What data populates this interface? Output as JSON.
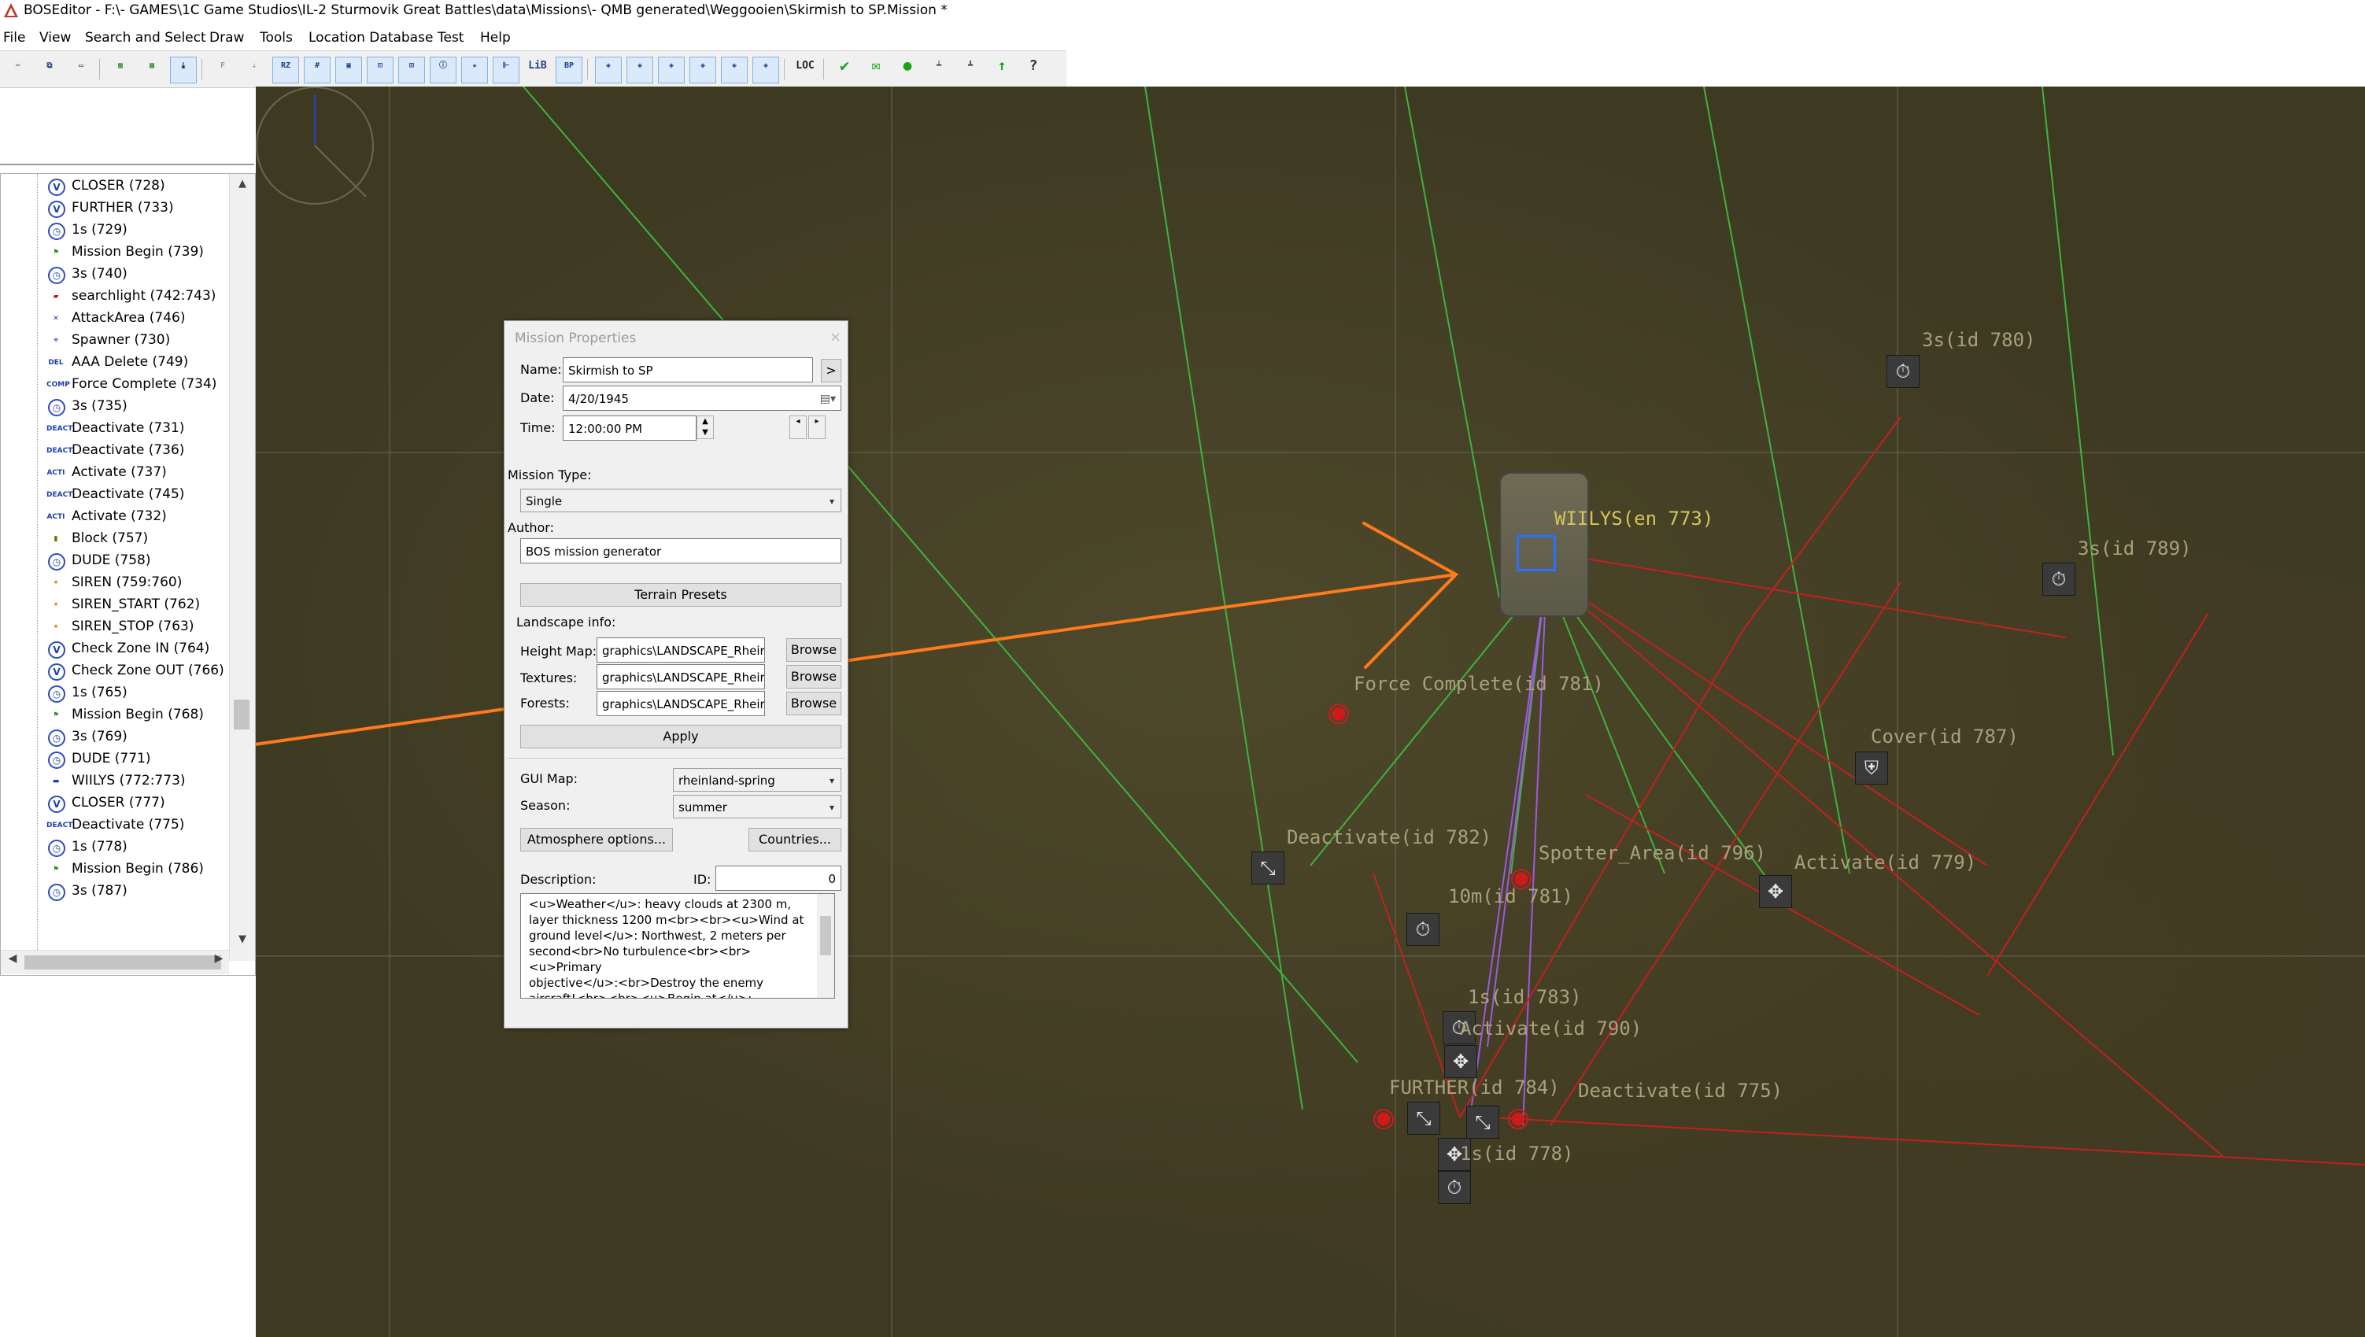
{
  "window": {
    "title": "BOSEditor - F:\\- GAMES\\1C Game Studios\\IL-2 Sturmovik Great Battles\\data\\Missions\\- QMB generated\\Weggooien\\Skirmish to SP.Mission *"
  },
  "menu": [
    "File",
    "View",
    "Search and Select",
    "Draw",
    "Tools",
    "Location Database",
    "Test",
    "Help"
  ],
  "toolbar": {
    "groups": [
      [
        "cut-icon",
        "copy-icon",
        "paste-icon"
      ],
      [
        "map-green-icon",
        "map-layers-icon",
        "download-icon"
      ],
      [
        "F",
        "import-icon",
        "RZ",
        "grid-icon",
        "frame-icon",
        "CAP",
        "MTC",
        "info-icon",
        "OBJ FAV",
        "align-icon",
        "LIB",
        "BP"
      ],
      [
        "MCU OBJ",
        "MCU TRR",
        "MCU MIS",
        "MCU SEL",
        "MCU UNIT",
        "MCU ARW"
      ],
      [
        "LOC",
        "check-icon",
        "envelope-icon",
        "green-dot-icon",
        "ruler-icon",
        "ruler2-icon",
        "arrow-up-icon",
        "help-icon"
      ]
    ],
    "labels": {
      "rz": "RZ",
      "lib": "LiB",
      "bp": "BP",
      "loc": "LOC",
      "f": "F"
    }
  },
  "tree": {
    "items": [
      {
        "icon": "V",
        "label": "CLOSER (728)"
      },
      {
        "icon": "V",
        "label": "FURTHER (733)"
      },
      {
        "icon": "timer",
        "label": "1s (729)"
      },
      {
        "icon": "flag",
        "label": "Mission Begin (739)"
      },
      {
        "icon": "timer",
        "label": "3s (740)"
      },
      {
        "icon": "tank",
        "label": "searchlight (742:743)"
      },
      {
        "icon": "attack",
        "label": "AttackArea (746)"
      },
      {
        "icon": "spawn",
        "label": "Spawner (730)"
      },
      {
        "icon": "DEL",
        "label": "AAA Delete (749)"
      },
      {
        "icon": "COMP",
        "label": "Force Complete (734)"
      },
      {
        "icon": "timer",
        "label": "3s (735)"
      },
      {
        "icon": "DEACT",
        "label": "Deactivate (731)"
      },
      {
        "icon": "DEACT",
        "label": "Deactivate (736)"
      },
      {
        "icon": "ACTI",
        "label": "Activate (737)"
      },
      {
        "icon": "DEACT",
        "label": "Deactivate (745)"
      },
      {
        "icon": "ACTI",
        "label": "Activate (732)"
      },
      {
        "icon": "block",
        "label": "Block (757)"
      },
      {
        "icon": "timer",
        "label": "DUDE (758)"
      },
      {
        "icon": "siren",
        "label": "SIREN (759:760)"
      },
      {
        "icon": "siren",
        "label": "SIREN_START (762)"
      },
      {
        "icon": "siren",
        "label": "SIREN_STOP (763)"
      },
      {
        "icon": "V",
        "label": "Check Zone IN (764)"
      },
      {
        "icon": "V",
        "label": "Check Zone OUT (766)"
      },
      {
        "icon": "timer",
        "label": "1s (765)"
      },
      {
        "icon": "flag",
        "label": "Mission Begin (768)"
      },
      {
        "icon": "timer",
        "label": "3s (769)"
      },
      {
        "icon": "timer",
        "label": "DUDE (771)"
      },
      {
        "icon": "car",
        "label": "WIILYS (772:773)"
      },
      {
        "icon": "V",
        "label": "CLOSER (777)"
      },
      {
        "icon": "DEACT",
        "label": "Deactivate (775)"
      },
      {
        "icon": "timer",
        "label": "1s (778)"
      },
      {
        "icon": "flag",
        "label": "Mission Begin (786)"
      },
      {
        "icon": "timer",
        "label": "3s (787)"
      }
    ]
  },
  "dialog": {
    "title": "Mission Properties",
    "close": "×",
    "name_label": "Name:",
    "name_value": "Skirmish to SP",
    "name_btn": ">",
    "date_label": "Date:",
    "date_value": "4/20/1945",
    "time_label": "Time:",
    "time_value": "12:00:00 PM",
    "mission_type_label": "Mission Type:",
    "mission_type_value": "Single",
    "author_label": "Author:",
    "author_value": "BOS mission generator",
    "terrain_presets": "Terrain Presets",
    "landscape_info": "Landscape info:",
    "height_map_label": "Height Map:",
    "height_map_value": "graphics\\LANDSCAPE_Rheir",
    "textures_label": "Textures:",
    "textures_value": "graphics\\LANDSCAPE_Rheir",
    "forests_label": "Forests:",
    "forests_value": "graphics\\LANDSCAPE_Rheir",
    "browse": "Browse",
    "apply": "Apply",
    "gui_map_label": "GUI Map:",
    "gui_map_value": "rheinland-spring",
    "season_label": "Season:",
    "season_value": "summer",
    "atmosphere_btn": "Atmosphere options...",
    "countries_btn": "Countries...",
    "description_label": "Description:",
    "id_label": "ID:",
    "id_value": "0",
    "description_lines": [
      "<u>Weather</u>: heavy clouds at 2300 m,",
      "layer thickness 1200 m<br><br><u>Wind at",
      "ground level</u>: Northwest, 2 meters per",
      "second<br>No turbulence<br><br><u>Primary",
      "objective</u>:<br>Destroy the enemy",
      "aircraft!<br><br><u>Begin at</u>:"
    ]
  },
  "map": {
    "labels": [
      {
        "text": "3s(id 780)"
      },
      {
        "text": "3s(id 789)"
      },
      {
        "text": "WIILYS(en 773)"
      },
      {
        "text": "Force Complete(id 781)"
      },
      {
        "text": "Cover(id 787)"
      },
      {
        "text": "Deactivate(id 782)"
      },
      {
        "text": "Spotter_Area(id 796)"
      },
      {
        "text": "Activate(id 779)"
      },
      {
        "text": "10m(id 781)"
      },
      {
        "text": "1s(id 783)"
      },
      {
        "text": "Activate(id 790)"
      },
      {
        "text": "FURTHER(id 784)"
      },
      {
        "text": "Deactivate(id 775)"
      },
      {
        "text": "1s(id 778)"
      }
    ],
    "colors": {
      "ground": "#3e3a22",
      "arrow": "#ff7a1a",
      "green_link": "#3fb23f",
      "red_link": "#c22020",
      "purple_link": "#9b5be0"
    }
  }
}
